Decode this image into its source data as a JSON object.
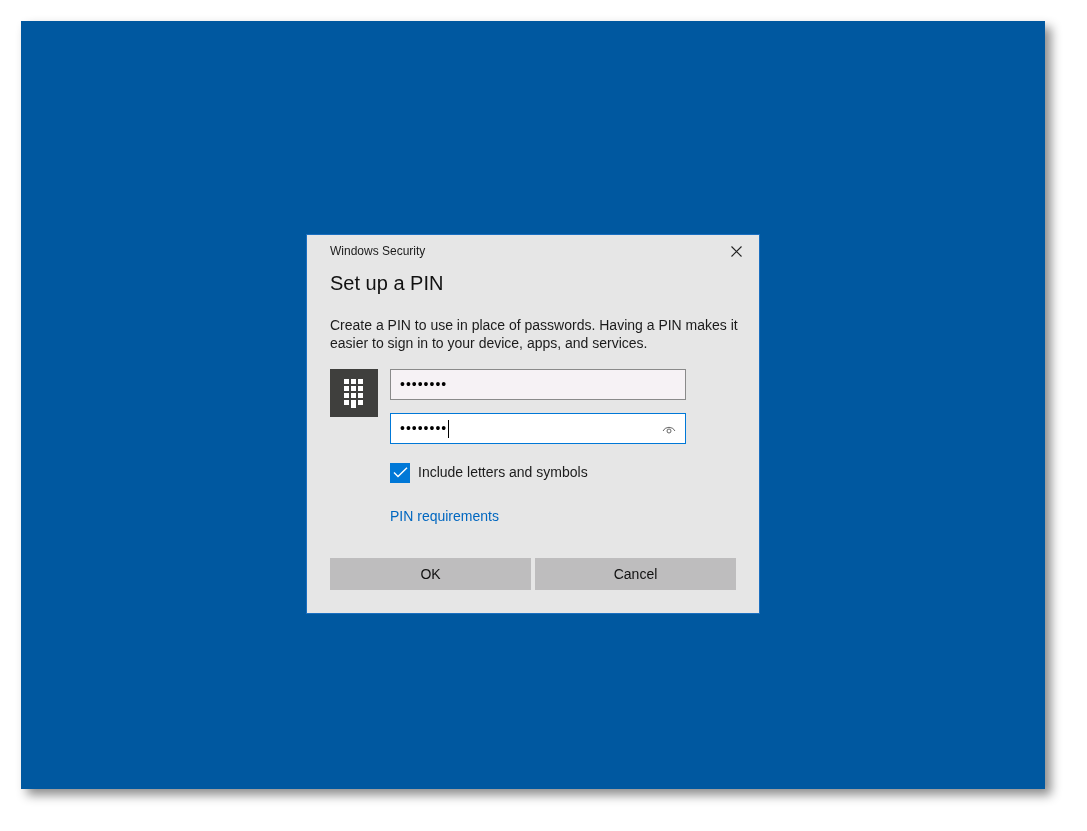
{
  "dialog": {
    "title": "Windows Security",
    "heading": "Set up a PIN",
    "description": "Create a PIN to use in place of passwords. Having a PIN makes it easier to sign in to your device, apps, and services.",
    "fields": [
      {
        "value": "••••••••",
        "focused": false,
        "reveal_button": false
      },
      {
        "value": "••••••••",
        "focused": true,
        "reveal_button": true
      }
    ],
    "checkbox": {
      "label": "Include letters and symbols",
      "checked": true
    },
    "link": "PIN requirements",
    "buttons": [
      "OK",
      "Cancel"
    ]
  }
}
